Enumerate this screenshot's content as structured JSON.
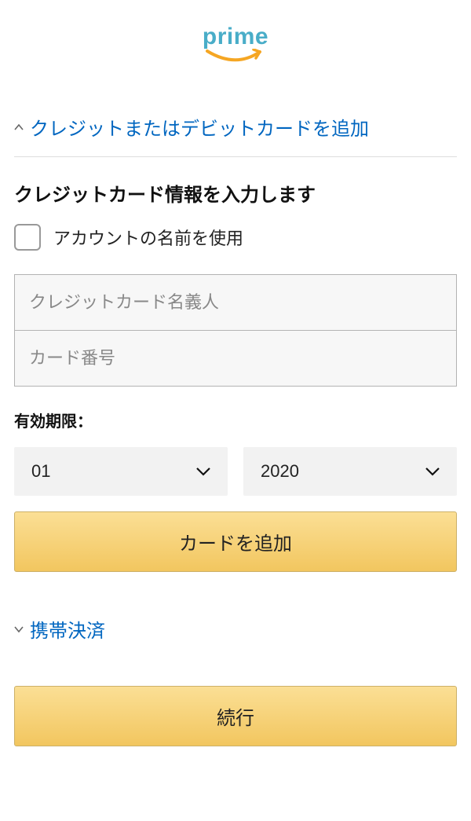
{
  "logo": {
    "text": "prime"
  },
  "accordion1": {
    "title": "クレジットまたはデビットカードを追加"
  },
  "form": {
    "section_title": "クレジットカード情報を入力します",
    "use_account_name_label": "アカウントの名前を使用",
    "cardholder_placeholder": "クレジットカード名義人",
    "cardnumber_placeholder": "カード番号",
    "expiry_label": "有効期限：",
    "month_value": "01",
    "year_value": "2020",
    "add_card_button": "カードを追加"
  },
  "accordion2": {
    "title": "携帯決済"
  },
  "continue_button": "続行"
}
